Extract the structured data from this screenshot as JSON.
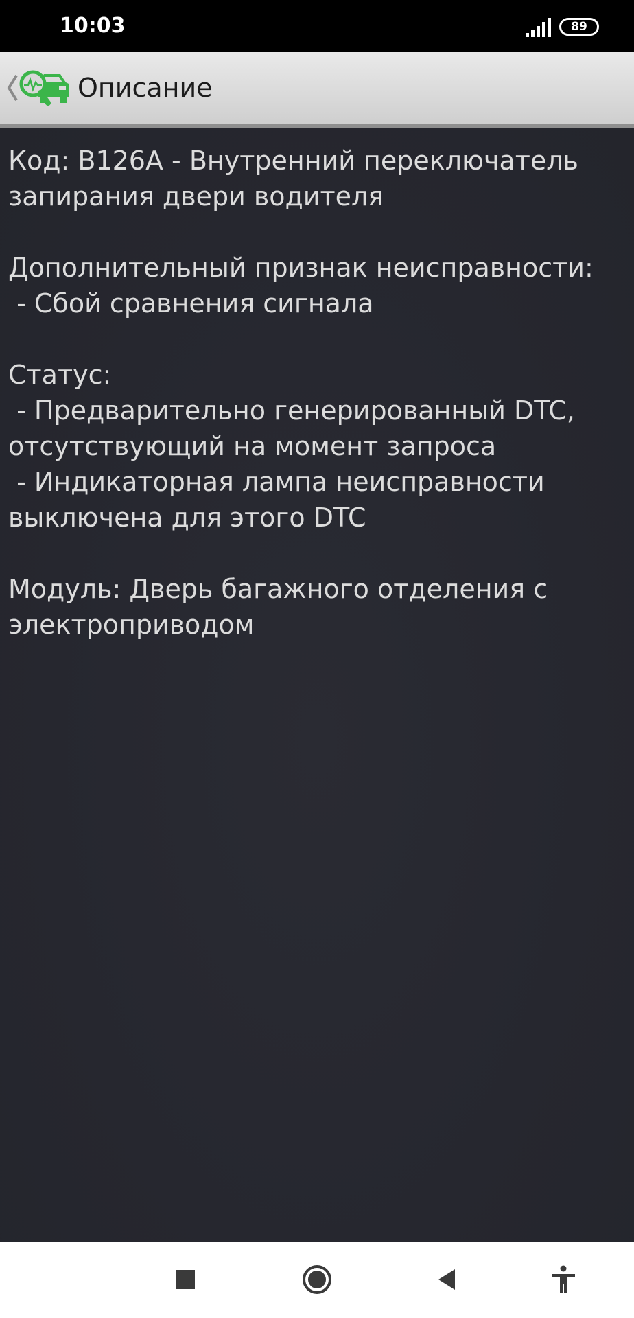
{
  "status_bar": {
    "time": "10:03",
    "battery_level": "89"
  },
  "app_bar": {
    "title": "Описание",
    "logo_color": "#3bb54a"
  },
  "description": {
    "lines": [
      "Код: B126A - Внутренний переключатель",
      "запирания двери водителя",
      "",
      "Дополнительный признак неисправности:",
      " - Сбой сравнения сигнала",
      "",
      "Статус:",
      " - Предварительно генерированный DTC,",
      "отсутствующий на момент запроса",
      " - Индикаторная лампа неисправности",
      "выключена для этого DTC",
      "",
      "Модуль: Дверь багажного отделения с",
      "электроприводом"
    ]
  },
  "nav_bar": {
    "buttons": [
      "recent-apps-icon",
      "home-icon",
      "back-icon",
      "accessibility-icon"
    ]
  },
  "colors": {
    "background": "#26272f",
    "text": "#dcdcdc",
    "accent": "#3bb54a"
  }
}
